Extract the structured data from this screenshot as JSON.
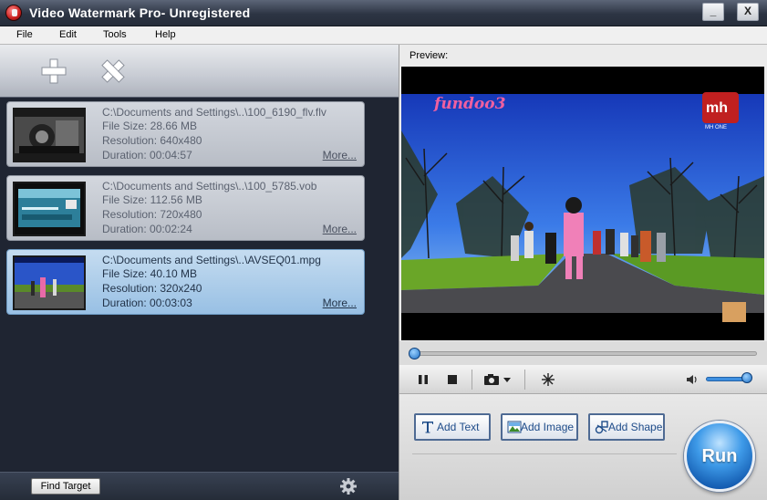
{
  "window": {
    "title": "Video Watermark Pro- Unregistered",
    "minimize": "_",
    "maximize": "□",
    "close": "X"
  },
  "menu": [
    "File",
    "Edit",
    "Tools",
    "Help"
  ],
  "toolbar": {
    "add_icon": "plus-icon",
    "remove_icon": "x-icon"
  },
  "files": [
    {
      "path": "C:\\Documents and Settings\\..\\100_6190_flv.flv",
      "size": "File Size: 28.66 MB",
      "resolution": "Resolution: 640x480",
      "duration": "Duration: 00:04:57",
      "more": "More...",
      "selected": false
    },
    {
      "path": "C:\\Documents and Settings\\..\\100_5785.vob",
      "size": "File Size: 112.56 MB",
      "resolution": "Resolution: 720x480",
      "duration": "Duration: 00:02:24",
      "more": "More...",
      "selected": false
    },
    {
      "path": "C:\\Documents and Settings\\..\\AVSEQ01.mpg",
      "size": "File Size: 40.10 MB",
      "resolution": "Resolution: 320x240",
      "duration": "Duration: 00:03:03",
      "more": "More...",
      "selected": true
    }
  ],
  "bottom": {
    "find_target": "Find Target",
    "settings_icon": "gear-icon"
  },
  "preview": {
    "label": "Preview:",
    "overlay_left": "fundoo3",
    "overlay_logo": "mh",
    "overlay_logo_sub": "MH ONE",
    "seek_position": 0.01,
    "volume": 0.9
  },
  "actions": {
    "add_text": "Add Text",
    "add_image": "Add Image",
    "add_shape": "Add Shape",
    "run": "Run"
  },
  "colors": {
    "title_bar": "#2d3544",
    "left_bg": "#1f2532",
    "selected_item": "#98c0e4",
    "accent_blue": "#1f6fc4"
  }
}
